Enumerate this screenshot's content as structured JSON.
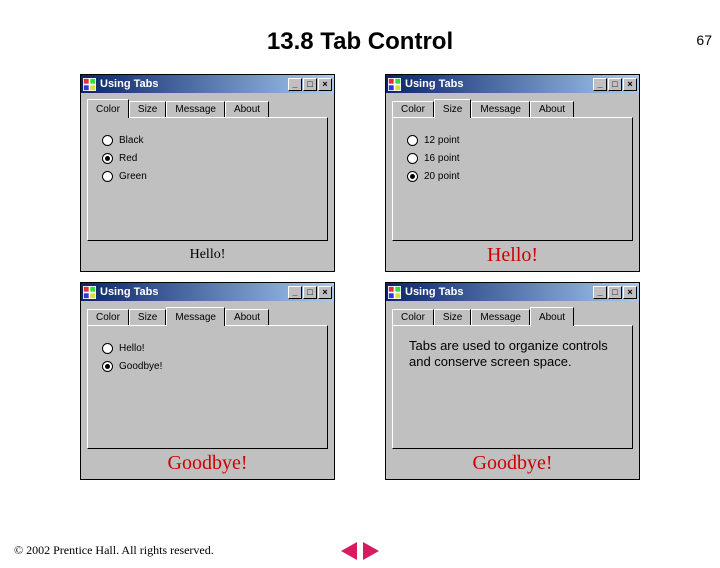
{
  "page_number": "67",
  "heading": "13.8  Tab Control",
  "footer": "© 2002 Prentice Hall.  All rights reserved.",
  "window_title": "Using Tabs",
  "title_buttons": {
    "min": "_",
    "max": "□",
    "close": "×"
  },
  "tabs": [
    "Color",
    "Size",
    "Message",
    "About"
  ],
  "panels": {
    "color": {
      "active_tab": 0,
      "options": [
        "Black",
        "Red",
        "Green"
      ],
      "selected": 1,
      "output": "Hello!",
      "output_class": "out-small"
    },
    "size": {
      "active_tab": 1,
      "options": [
        "12 point",
        "16 point",
        "20 point"
      ],
      "selected": 2,
      "output": "Hello!",
      "output_class": "out-big-red"
    },
    "message": {
      "active_tab": 2,
      "options": [
        "Hello!",
        "Goodbye!"
      ],
      "selected": 1,
      "output": "Goodbye!",
      "output_class": "out-big-red"
    },
    "about": {
      "active_tab": 3,
      "text": "Tabs are used to organize controls and conserve screen space.",
      "output": "Goodbye!",
      "output_class": "out-big-red"
    }
  }
}
